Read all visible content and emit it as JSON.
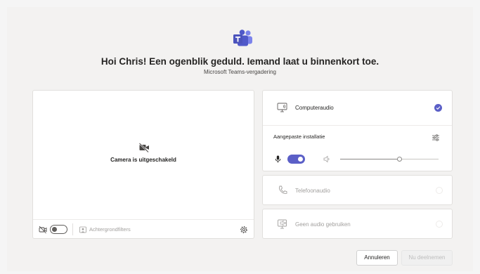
{
  "header": {
    "logo": "teams-logo",
    "greeting": "Hoi Chris! Een ogenblik geduld. Iemand laat u binnenkort toe.",
    "subtitle": "Microsoft Teams-vergadering"
  },
  "video": {
    "status_icon": "camera-off-icon",
    "status_text": "Camera is uitgeschakeld",
    "camera_toggle_on": false,
    "background_filters_label": "Achtergrondfilters"
  },
  "audio": {
    "computer": {
      "label": "Computeraudio",
      "selected": true,
      "custom_setup_label": "Aangepaste installatie",
      "mic_on": true,
      "speaker_volume": 0.6
    },
    "phone": {
      "label": "Telefoonaudio",
      "enabled": false
    },
    "no_audio": {
      "label": "Geen audio gebruiken",
      "enabled": false
    }
  },
  "actions": {
    "cancel_label": "Annuleren",
    "join_label": "Nu deelnemen"
  },
  "colors": {
    "accent": "#5b5fc7",
    "background": "#f3f2f1"
  }
}
